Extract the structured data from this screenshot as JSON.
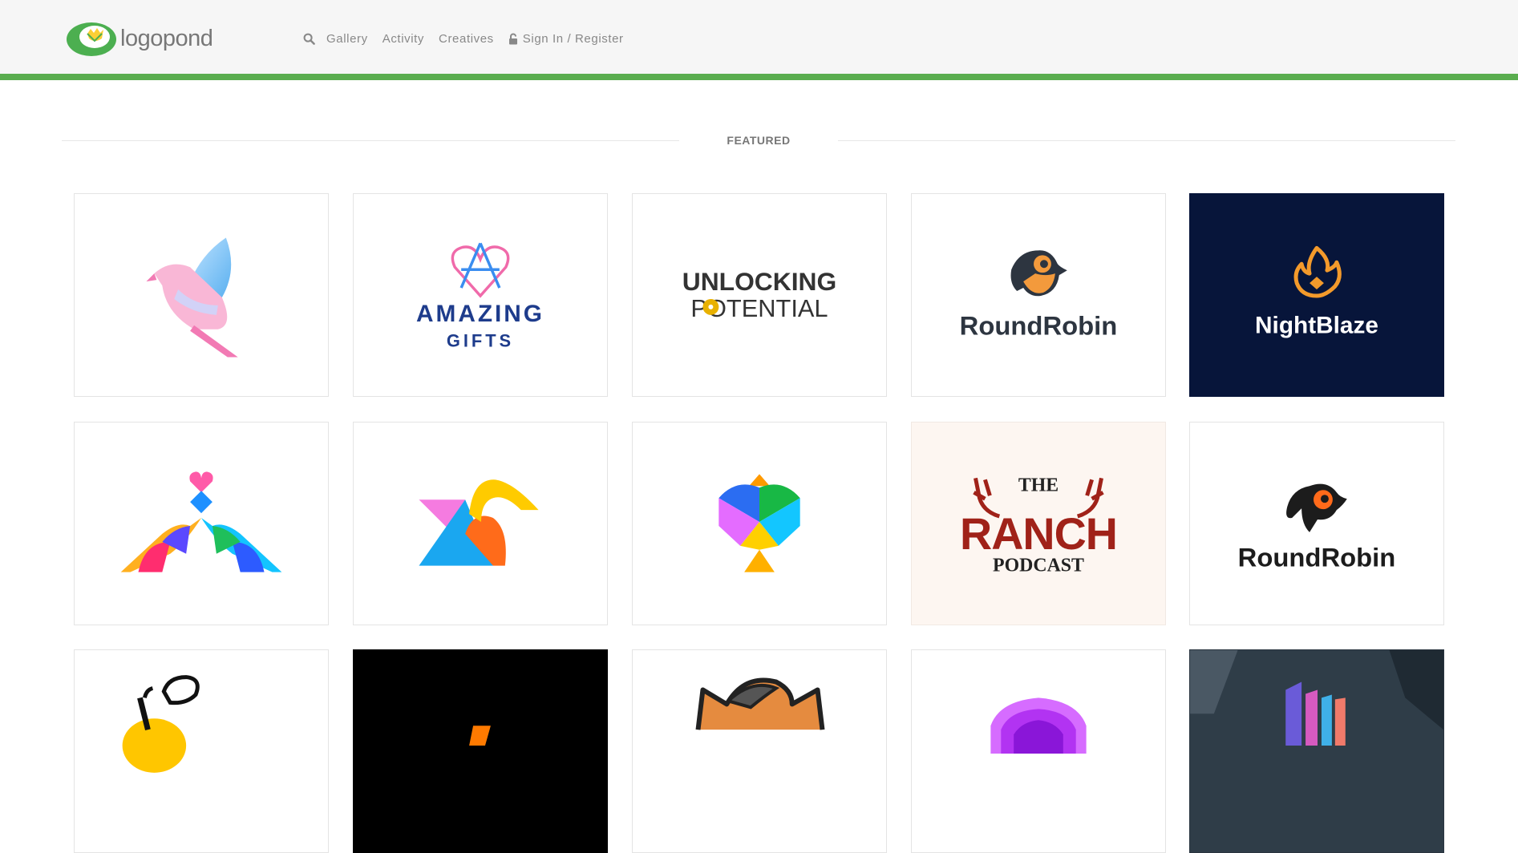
{
  "header": {
    "logo_text": "logopond",
    "nav": {
      "gallery": "Gallery",
      "activity": "Activity",
      "creatives": "Creatives",
      "signin": "Sign In / Register"
    }
  },
  "section": {
    "title": "FEATURED"
  },
  "colors": {
    "accent": "#5aad4f",
    "header_bg": "#f6f6f6"
  },
  "cards": [
    {
      "text1": "",
      "text2": ""
    },
    {
      "text1": "AMAZING",
      "text2": "GIFTS"
    },
    {
      "text1": "UNLOCKING",
      "text2": "POTENTIAL"
    },
    {
      "text1": "RoundRobin",
      "text2": ""
    },
    {
      "text1": "NightBlaze",
      "text2": ""
    },
    {
      "text1": "",
      "text2": ""
    },
    {
      "text1": "",
      "text2": ""
    },
    {
      "text1": "",
      "text2": ""
    },
    {
      "text1": "THE",
      "text2": "RANCH",
      "text3": "PODCAST"
    },
    {
      "text1": "RoundRobin",
      "text2": ""
    }
  ]
}
